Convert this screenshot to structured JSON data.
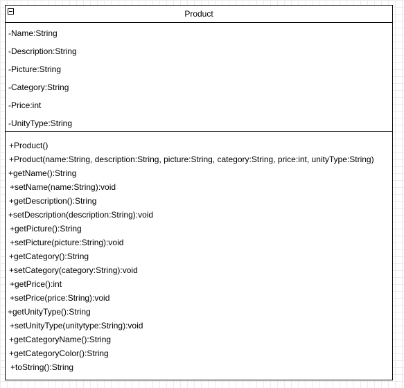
{
  "class_name": "Product",
  "attributes": [
    "-Name:String",
    "-Description:String",
    "-Picture:String",
    "-Category:String",
    "-Price:int",
    "-UnityType:String"
  ],
  "methods": [
    "+Product()",
    "+Product(name:String, description:String, picture:String, category:String, price:int, unityType:String)",
    "+getName():String",
    "+setName(name:String):void",
    "+getDescription():String",
    "+setDescription(description:String):void",
    "+getPicture():String",
    "+setPicture(picture:String):void",
    "+getCategory():String",
    "+setCategory(category:String):void",
    "+getPrice():int",
    "+setPrice(price:String):void",
    "+getUnityType():String",
    "+setUnityType(unitytype:String):void",
    "+getCategoryName():String",
    "+getCategoryColor():String",
    "+toString():String"
  ]
}
